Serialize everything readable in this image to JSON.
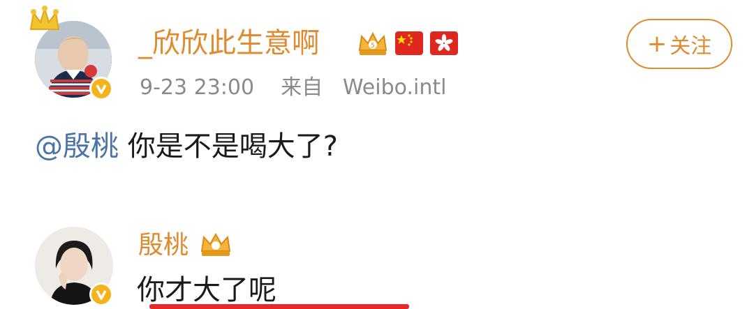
{
  "post": {
    "username": "_欣欣此生意啊",
    "time": "9-23 23:00",
    "source_prefix": "来自",
    "source": "Weibo.intl",
    "follow_label": "关注",
    "follow_plus": "+",
    "mention": "@殷桃",
    "text": " 你是不是喝大了?"
  },
  "reply": {
    "username": "殷桃",
    "text": "你才大了呢"
  },
  "colors": {
    "username": "#e08a2d",
    "mention": "#4a73a8",
    "meta": "#8a8a8a",
    "verified_badge": "#f6b21a",
    "underline": "#e32b2b"
  },
  "icons": {
    "crown_deco": "crown-icon",
    "vip": "vip-crown-icon",
    "flags": [
      "china-flag-icon",
      "hong-kong-flag-icon"
    ],
    "verified": "verified-badge-icon"
  }
}
